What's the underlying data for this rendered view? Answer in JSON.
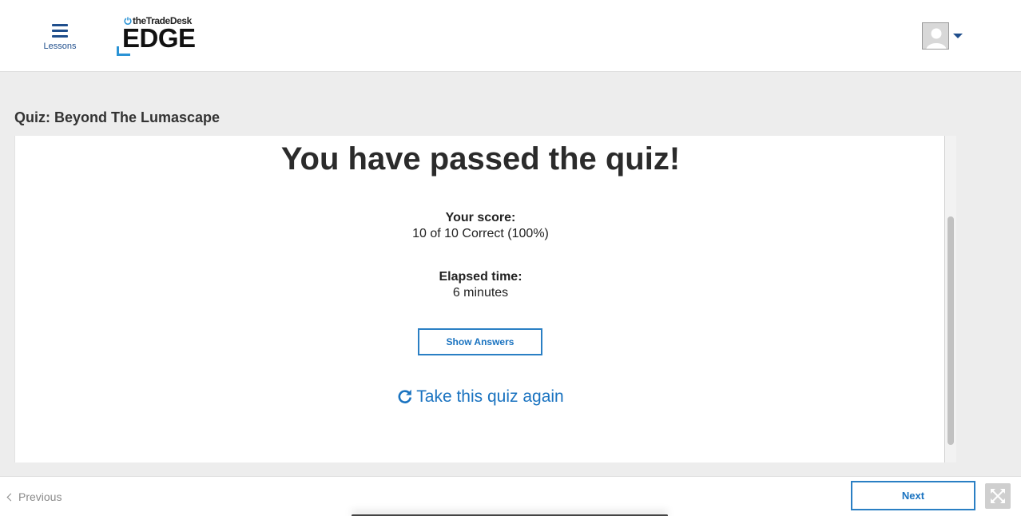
{
  "header": {
    "menu_label": "Lessons",
    "logo_top": "theTradeDesk",
    "logo_main": "EDGE",
    "avatar_icon": "user-avatar-icon",
    "caret_icon": "caret-down-icon"
  },
  "page": {
    "title": "Quiz: Beyond The Lumascape"
  },
  "result": {
    "headline": "You have passed the quiz!",
    "score_label": "Your score:",
    "score_value": "10 of 10 Correct (100%)",
    "elapsed_label": "Elapsed time:",
    "elapsed_value": "6 minutes",
    "show_answers": "Show Answers",
    "retake": "Take this quiz again"
  },
  "footer": {
    "previous": "Previous",
    "next": "Next"
  },
  "colors": {
    "accent": "#1a73c0",
    "brand_navy": "#1f4e8c",
    "logo_blue": "#2a93d5"
  }
}
